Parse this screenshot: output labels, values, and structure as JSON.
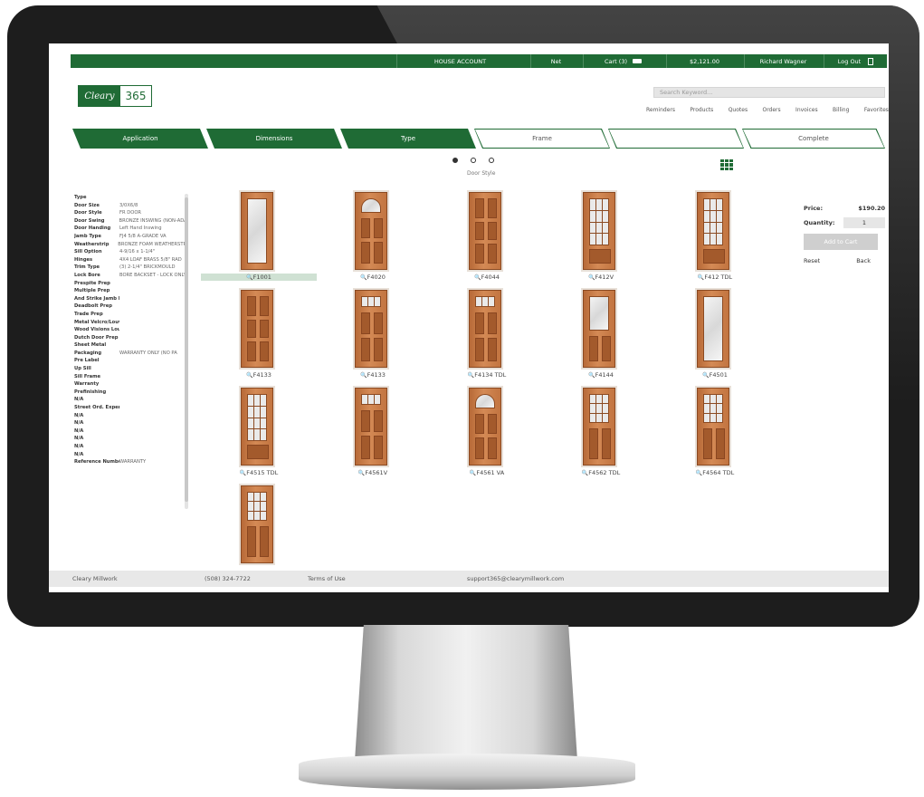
{
  "topbar": {
    "account": "HOUSE ACCOUNT",
    "net": "Net",
    "cart": "Cart (3)",
    "amount": "$2,121.00",
    "user": "Richard Wagner",
    "logout": "Log Out"
  },
  "logo": {
    "part1": "Cleary",
    "part2": "365"
  },
  "search": {
    "placeholder": "Search Keyword..."
  },
  "nav": [
    "Reminders",
    "Products",
    "Quotes",
    "Orders",
    "Invoices",
    "Billing",
    "Favorites"
  ],
  "steps": [
    "Application",
    "Dimensions",
    "Type",
    "Frame",
    "",
    "Complete"
  ],
  "carousel_label": "Door Style",
  "specs": [
    [
      "Type",
      ""
    ],
    [
      "Door Size",
      "3/0X6/8"
    ],
    [
      "Door Style",
      "FR DOOR"
    ],
    [
      "Door Swing",
      "BRONZE INSWING (NON-ADA)"
    ],
    [
      "Door Handing",
      "Left Hand Inswing"
    ],
    [
      "Jamb Type",
      "FJ4 5/8 A-GRADE VA"
    ],
    [
      "Weatherstrip",
      "BRONZE FOAM WEATHERSTRIP"
    ],
    [
      "Sill Option",
      "4-9/16 x 1-1/4\""
    ],
    [
      "Hinges",
      "4X4 LOAF BRASS 5/8\" RAD"
    ],
    [
      "Trim Type",
      "(3) 2-1/4\" BRICKMOULD"
    ],
    [
      "Lock Bore",
      "BORE BACKSET - LOCK ONLY"
    ],
    [
      "Prespite Prep",
      ""
    ],
    [
      "Multiple Prep",
      ""
    ],
    [
      "And Strike Jamb Pr",
      ""
    ],
    [
      "Deadbolt Prep",
      ""
    ],
    [
      "Trade Prep",
      ""
    ],
    [
      "Metal Velcro/Louv",
      ""
    ],
    [
      "Wood Visions Louv",
      ""
    ],
    [
      "Dutch Door Prep",
      ""
    ],
    [
      "Sheet Metal",
      ""
    ],
    [
      "Packaging",
      "WARRANTY ONLY (NO PA"
    ],
    [
      "Pre Label",
      ""
    ],
    [
      "Up Sill",
      ""
    ],
    [
      "Sill Frame",
      ""
    ],
    [
      "Warranty",
      ""
    ],
    [
      "Prefinishing",
      ""
    ],
    [
      "N/A",
      ""
    ],
    [
      "Street Ord. Expense",
      ""
    ],
    [
      "N/A",
      ""
    ],
    [
      "N/A",
      ""
    ],
    [
      "N/A",
      ""
    ],
    [
      "N/A",
      ""
    ],
    [
      "N/A",
      ""
    ],
    [
      "N/A",
      ""
    ],
    [
      "Reference Number",
      "WARRANTY"
    ]
  ],
  "doors": [
    {
      "label": "F1001",
      "style": "glass",
      "selected": true
    },
    {
      "label": "F4020",
      "style": "fan",
      "selected": false
    },
    {
      "label": "F4044",
      "style": "panels",
      "selected": false
    },
    {
      "label": "F412V",
      "style": "lites",
      "selected": false
    },
    {
      "label": "F412 TDL",
      "style": "lites",
      "selected": false
    },
    {
      "label": "F4133",
      "style": "panels",
      "selected": false
    },
    {
      "label": "F4133",
      "style": "toplite",
      "selected": false
    },
    {
      "label": "F4134 TDL",
      "style": "toplite",
      "selected": false
    },
    {
      "label": "F4144",
      "style": "halfglass",
      "selected": false
    },
    {
      "label": "F4501",
      "style": "glass",
      "selected": false
    },
    {
      "label": "F4515 TDL",
      "style": "lites",
      "selected": false
    },
    {
      "label": "F4561V",
      "style": "toplite",
      "selected": false
    },
    {
      "label": "F4561 VA",
      "style": "fan",
      "selected": false
    },
    {
      "label": "F4562 TDL",
      "style": "halflites",
      "selected": false
    },
    {
      "label": "F4564 TDL",
      "style": "halflites",
      "selected": false
    },
    {
      "label": "",
      "style": "halflites",
      "selected": false
    }
  ],
  "price_panel": {
    "price_label": "Price:",
    "price": "$190.20",
    "qty_label": "Quantity:",
    "qty": "1",
    "add_label": "Add to Cart",
    "reset": "Reset",
    "back": "Back"
  },
  "footer": {
    "company": "Cleary Millwork",
    "phone": "(508) 324-7722",
    "terms": "Terms of Use",
    "email": "support365@clearymillwork.com"
  },
  "colors": {
    "brand": "#1f6b35",
    "selected_row": "#cfe1d3"
  }
}
